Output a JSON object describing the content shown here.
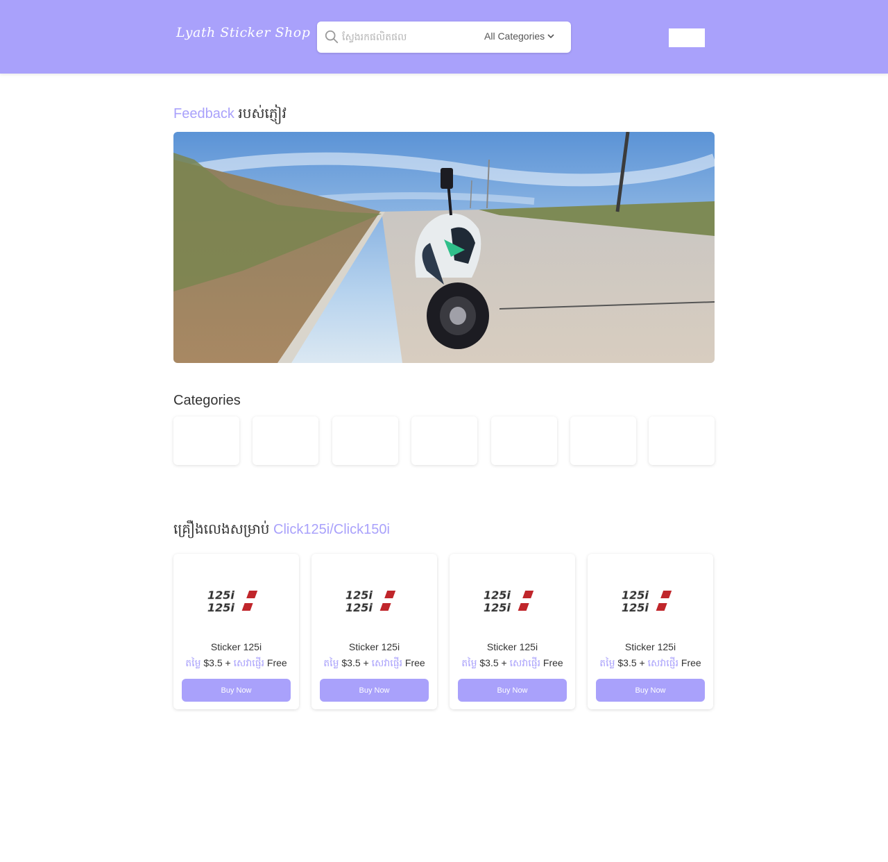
{
  "header": {
    "logo": "Lyath Sticker Shop",
    "search_placeholder": "ស្វែងរកផលិតផល",
    "category_select": "All Categories"
  },
  "feedback": {
    "title_accent": "Feedback",
    "title_rest": "របស់ភ្ញៀវ"
  },
  "categories": {
    "title": "Categories",
    "tile_count": 7
  },
  "products_section": {
    "title_prefix": "គ្រឿងលេងសម្រាប់",
    "title_accent": "Click125i/Click150i"
  },
  "products": [
    {
      "name": "Sticker 125i",
      "price_label": "តម្លៃ",
      "price": "$3.5 +",
      "shipping_label": "សេវាផ្ញើរ",
      "shipping": "Free",
      "button": "Buy Now",
      "image_text": "125i"
    },
    {
      "name": "Sticker 125i",
      "price_label": "តម្លៃ",
      "price": "$3.5 +",
      "shipping_label": "សេវាផ្ញើរ",
      "shipping": "Free",
      "button": "Buy Now",
      "image_text": "125i"
    },
    {
      "name": "Sticker 125i",
      "price_label": "តម្លៃ",
      "price": "$3.5 +",
      "shipping_label": "សេវាផ្ញើរ",
      "shipping": "Free",
      "button": "Buy Now",
      "image_text": "125i"
    },
    {
      "name": "Sticker 125i",
      "price_label": "តម្លៃ",
      "price": "$3.5 +",
      "shipping_label": "សេវាផ្ញើរ",
      "shipping": "Free",
      "button": "Buy Now",
      "image_text": "125i"
    }
  ],
  "colors": {
    "brand": "#a9a1fb",
    "text": "#333333"
  }
}
